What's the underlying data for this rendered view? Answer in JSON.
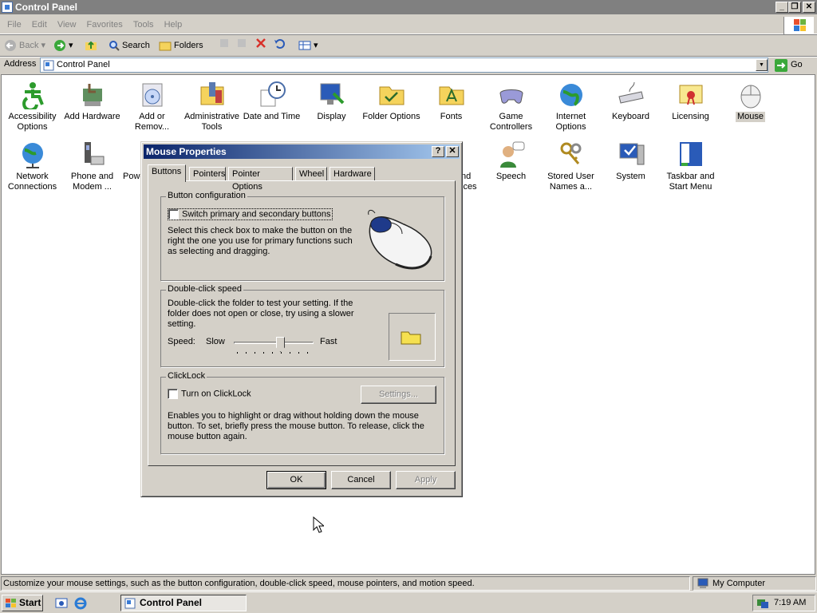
{
  "window": {
    "title": "Control Panel",
    "min": "_",
    "restore": "❐",
    "close": "✕"
  },
  "menu": [
    "File",
    "Edit",
    "View",
    "Favorites",
    "Tools",
    "Help"
  ],
  "toolbar": {
    "back": "Back",
    "search": "Search",
    "folders": "Folders"
  },
  "address": {
    "label": "Address",
    "value": "Control Panel",
    "go": "Go"
  },
  "icons": [
    {
      "label": "Accessibility Options",
      "icon": "accessibility-icon"
    },
    {
      "label": "Add Hardware",
      "icon": "hardware-icon"
    },
    {
      "label": "Add or Remov...",
      "icon": "add-remove-icon"
    },
    {
      "label": "Administrative Tools",
      "icon": "admin-tools-icon"
    },
    {
      "label": "Date and Time",
      "icon": "clock-icon"
    },
    {
      "label": "Display",
      "icon": "display-icon"
    },
    {
      "label": "Folder Options",
      "icon": "folder-icon"
    },
    {
      "label": "Fonts",
      "icon": "fonts-icon"
    },
    {
      "label": "Game Controllers",
      "icon": "gamepad-icon"
    },
    {
      "label": "Internet Options",
      "icon": "globe-icon"
    },
    {
      "label": "Keyboard",
      "icon": "keyboard-icon"
    },
    {
      "label": "Licensing",
      "icon": "certificate-icon"
    },
    {
      "label": "Mouse",
      "icon": "mouse-icon"
    },
    {
      "label": "Network Connections",
      "icon": "network-icon"
    },
    {
      "label": "Phone and Modem ...",
      "icon": "phone-icon"
    },
    {
      "label": "Powe",
      "icon": "power-icon"
    },
    {
      "label": "nd ices",
      "icon": "sound-icon"
    },
    {
      "label": "Speech",
      "icon": "speech-icon"
    },
    {
      "label": "Stored User Names a...",
      "icon": "keys-icon"
    },
    {
      "label": "System",
      "icon": "system-icon"
    },
    {
      "label": "Taskbar and Start Menu",
      "icon": "taskbar-icon"
    }
  ],
  "dialog": {
    "title": "Mouse Properties",
    "help": "?",
    "close": "✕",
    "tabs": [
      "Buttons",
      "Pointers",
      "Pointer Options",
      "Wheel",
      "Hardware"
    ],
    "button_config": {
      "label": "Button configuration",
      "checkbox": "Switch primary and secondary buttons",
      "desc": "Select this check box to make the button on the right the one you use for primary functions such as selecting and dragging."
    },
    "double_click": {
      "label": "Double-click speed",
      "desc": "Double-click the folder to test your setting. If the folder does not open or close, try using a slower setting.",
      "speed": "Speed:",
      "slow": "Slow",
      "fast": "Fast",
      "slider_fraction": 0.6
    },
    "clicklock": {
      "label": "ClickLock",
      "checkbox": "Turn on ClickLock",
      "settings": "Settings...",
      "desc": "Enables you to highlight or drag without holding down the mouse button. To set, briefly press the mouse button. To release, click the mouse button again."
    },
    "ok": "OK",
    "cancel": "Cancel",
    "apply": "Apply"
  },
  "status": {
    "text": "Customize your mouse settings, such as the button configuration, double-click speed, mouse pointers, and motion speed.",
    "zone": "My Computer"
  },
  "taskbar": {
    "start": "Start",
    "task": "Control Panel",
    "time": "7:19 AM"
  }
}
